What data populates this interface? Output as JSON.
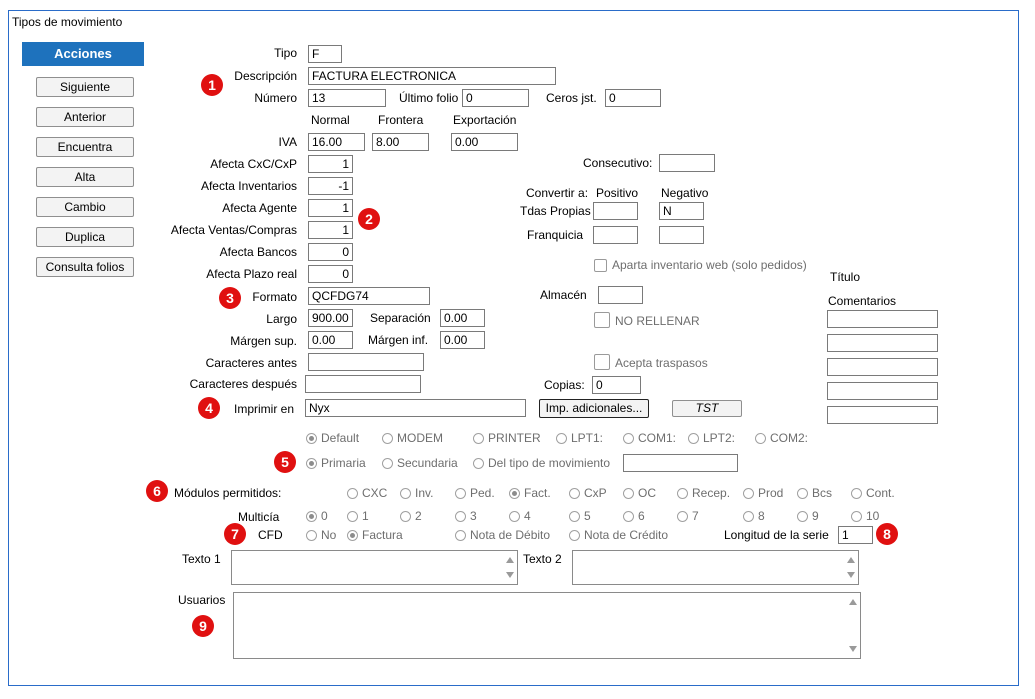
{
  "window": {
    "title": "Tipos de movimiento"
  },
  "sidebar": {
    "header": "Acciones",
    "buttons": [
      "Siguiente",
      "Anterior",
      "Encuentra",
      "Alta",
      "Cambio",
      "Duplica",
      "Consulta folios"
    ]
  },
  "badges": [
    "1",
    "2",
    "3",
    "4",
    "5",
    "6",
    "7",
    "8",
    "9"
  ],
  "form": {
    "tipo": {
      "label": "Tipo",
      "value": "F"
    },
    "descripcion": {
      "label": "Descripción",
      "value": "FACTURA ELECTRONICA"
    },
    "numero": {
      "label": "Número",
      "value": "13"
    },
    "ultimo_folio": {
      "label": "Último folio",
      "value": "0"
    },
    "ceros": {
      "label": "Ceros jst.",
      "value": "0"
    },
    "iva_headers": {
      "normal": "Normal",
      "frontera": "Frontera",
      "exportacion": "Exportación"
    },
    "iva": {
      "label": "IVA",
      "normal": "16.00",
      "frontera": "8.00",
      "exportacion": "0.00"
    },
    "afecta_cxc": {
      "label": "Afecta  CxC/CxP",
      "value": "1"
    },
    "afecta_inventarios": {
      "label": "Afecta  Inventarios",
      "value": "-1"
    },
    "afecta_agente": {
      "label": "Afecta  Agente",
      "value": "1"
    },
    "afecta_ventas": {
      "label": "Afecta  Ventas/Compras",
      "value": "1"
    },
    "afecta_bancos": {
      "label": "Afecta  Bancos",
      "value": "0"
    },
    "afecta_plazo": {
      "label": "Afecta  Plazo real",
      "value": "0"
    },
    "formato": {
      "label": "Formato",
      "value": "QCFDG74"
    },
    "largo": {
      "label": "Largo",
      "value": "900.00"
    },
    "separacion": {
      "label": "Separación",
      "value": "0.00"
    },
    "margen_sup": {
      "label": "Márgen sup.",
      "value": "0.00"
    },
    "margen_inf": {
      "label": "Márgen inf.",
      "value": "0.00"
    },
    "caracteres_antes": {
      "label": "Caracteres antes",
      "value": ""
    },
    "caracteres_despues": {
      "label": "Caracteres después",
      "value": ""
    },
    "imprimir_en": {
      "label": "Imprimir en",
      "value": "Nyx"
    },
    "imp_adicionales": "Imp. adicionales...",
    "tst": "TST",
    "consecutivo": {
      "label": "Consecutivo:",
      "value": ""
    },
    "convertir": {
      "label": "Convertir a:",
      "positivo": "Positivo",
      "negativo": "Negativo"
    },
    "tdas_propias": {
      "label": "Tdas Propias",
      "positivo": "",
      "negativo": "N"
    },
    "franquicia": {
      "label": "Franquicia",
      "positivo": "",
      "negativo": ""
    },
    "aparta_inventario": "Aparta inventario web (solo pedidos)",
    "almacen": {
      "label": "Almacén",
      "value": ""
    },
    "no_rellenar": "NO RELLENAR",
    "acepta_traspasos": "Acepta traspasos",
    "copias": {
      "label": "Copias:",
      "value": "0"
    },
    "titulo": "Título",
    "comentarios": "Comentarios",
    "printer_options": [
      "Default",
      "MODEM",
      "PRINTER",
      "LPT1:",
      "COM1:",
      "LPT2:",
      "COM2:"
    ],
    "print_source_options": [
      "Primaria",
      "Secundaria",
      "Del tipo de movimiento"
    ],
    "modulos": {
      "label": "Módulos permitidos:",
      "options": [
        "CXC",
        "Inv.",
        "Ped.",
        "Fact.",
        "CxP",
        "OC",
        "Recep.",
        "Prod",
        "Bcs",
        "Cont."
      ]
    },
    "multicia": {
      "label": "Multicía",
      "options": [
        "0",
        "1",
        "2",
        "3",
        "4",
        "5",
        "6",
        "7",
        "8",
        "9",
        "10"
      ]
    },
    "cfd": {
      "label": "CFD",
      "options": [
        "No",
        "Factura",
        "Nota de Débito",
        "Nota de Crédito"
      ]
    },
    "longitud_serie": {
      "label": "Longitud de la serie",
      "value": "1"
    },
    "texto1": {
      "label": "Texto 1"
    },
    "texto2": {
      "label": "Texto 2"
    },
    "usuarios": {
      "label": "Usuarios"
    }
  }
}
